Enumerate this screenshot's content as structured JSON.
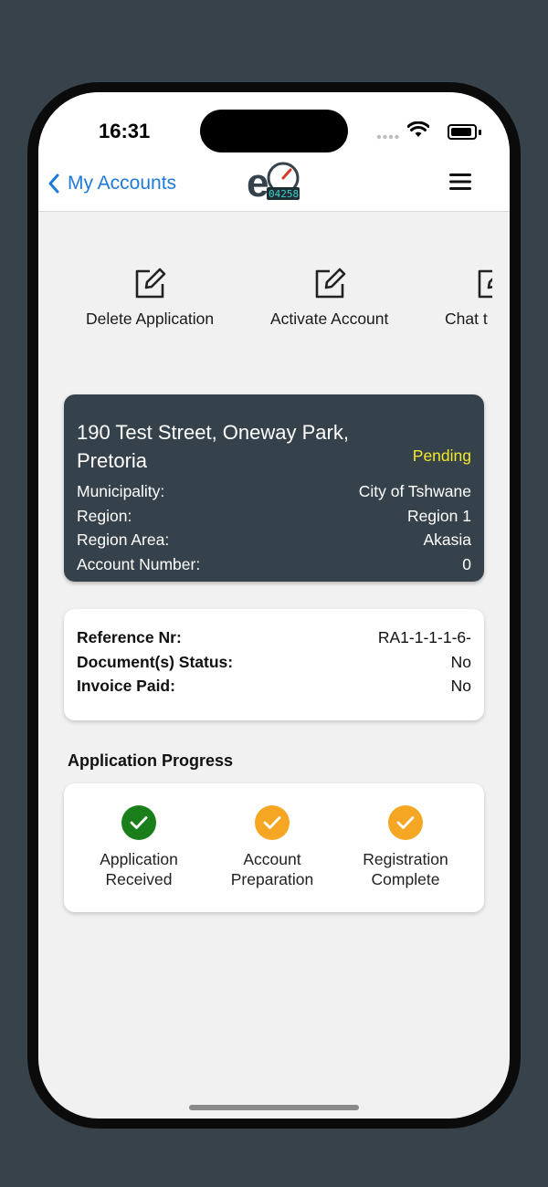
{
  "status_bar": {
    "time": "16:31"
  },
  "nav": {
    "back_label": "My Accounts",
    "logo_text": "04258"
  },
  "actions": [
    {
      "label": "Delete Application",
      "icon": "edit-icon"
    },
    {
      "label": "Activate Account",
      "icon": "edit-icon"
    },
    {
      "label": "Chat t",
      "icon": "edit-icon"
    }
  ],
  "account_card": {
    "address": "190 Test Street, Oneway Park, Pretoria",
    "status": "Pending",
    "rows": [
      {
        "label": "Municipality:",
        "value": "City of Tshwane"
      },
      {
        "label": "Region:",
        "value": "Region 1"
      },
      {
        "label": "Region Area:",
        "value": "Akasia"
      },
      {
        "label": "Account Number:",
        "value": "0"
      }
    ]
  },
  "details_card": {
    "rows": [
      {
        "label": "Reference Nr:",
        "value": "RA1-1-1-1-6-"
      },
      {
        "label": "Document(s) Status:",
        "value": "No"
      },
      {
        "label": "Invoice Paid:",
        "value": "No"
      }
    ]
  },
  "progress": {
    "title": "Application Progress",
    "steps": [
      {
        "line1": "Application",
        "line2": "Received",
        "state": "complete",
        "color": "#1a7f1a"
      },
      {
        "line1": "Account",
        "line2": "Preparation",
        "state": "pending",
        "color": "#f5a623"
      },
      {
        "line1": "Registration",
        "line2": "Complete",
        "state": "pending",
        "color": "#f5a623"
      }
    ]
  },
  "colors": {
    "accent": "#1f7ad6",
    "card_dark": "#36424b",
    "status_pending": "#f2e82b"
  }
}
